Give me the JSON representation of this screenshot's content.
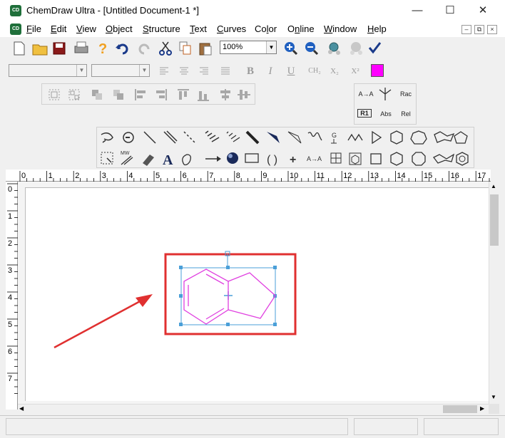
{
  "window": {
    "title": "ChemDraw Ultra - [Untitled Document-1 *]",
    "app_icon_text": "CD",
    "controls": {
      "minimize": "—",
      "maximize": "☐",
      "close": "✕"
    }
  },
  "menubar": {
    "items": [
      {
        "key": "F",
        "rest": "ile"
      },
      {
        "key": "E",
        "rest": "dit"
      },
      {
        "key": "V",
        "rest": "iew"
      },
      {
        "key": "O",
        "rest": "bject"
      },
      {
        "key": "S",
        "rest": "tructure"
      },
      {
        "key": "T",
        "rest": "ext"
      },
      {
        "key": "C",
        "rest": "urves"
      },
      {
        "key": "",
        "pre": "Co",
        "mid": "l",
        "post": "or"
      },
      {
        "key": "",
        "pre": "O",
        "mid": "n",
        "post": "line"
      },
      {
        "key": "W",
        "rest": "indow"
      },
      {
        "key": "H",
        "rest": "elp"
      }
    ],
    "mdi_controls": {
      "minimize": "–",
      "restore": "⧉",
      "close": "×"
    }
  },
  "toolbar": {
    "zoom_value": "100%",
    "color_swatch": "#ff00ff"
  },
  "format_bar": {
    "bold": "B",
    "italic": "I",
    "underline": "U",
    "formula": "CH₂",
    "subscript": "X₂",
    "superscript": "X²"
  },
  "stereo_panel": {
    "labels": [
      "A→A",
      "Rac",
      "R1",
      "Abs",
      "Rel"
    ]
  },
  "ruler": {
    "horizontal": [
      "0",
      "1",
      "2",
      "3",
      "4",
      "5",
      "6",
      "7",
      "8",
      "9",
      "10",
      "11",
      "12",
      "13",
      "14",
      "15",
      "16",
      "17"
    ],
    "vertical": [
      "0",
      "1",
      "2",
      "3",
      "4",
      "5",
      "6",
      "7"
    ]
  },
  "colors": {
    "molecule": "#e040e0",
    "selection": "#4a9fd8",
    "highlight_box": "#e03030",
    "arrow": "#e03030"
  }
}
